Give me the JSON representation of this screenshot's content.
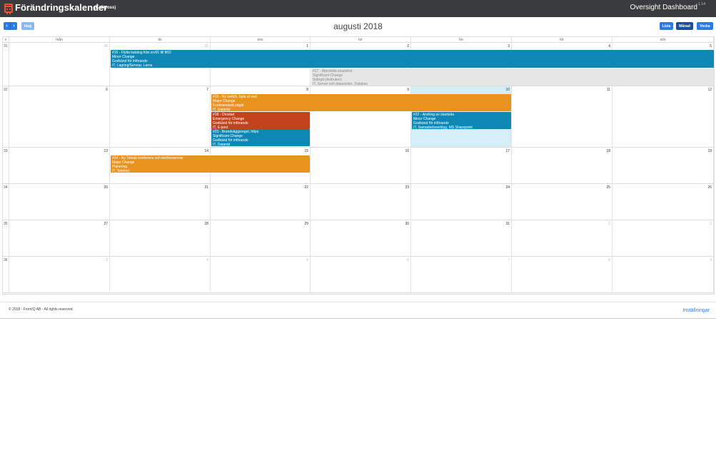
{
  "header": {
    "title": "Förändringskalender",
    "subtitle": "(Kalkyoss)",
    "dashboard_link": "Oversight Dashboard",
    "version": "1.14",
    "icon": "calendar-icon",
    "icon_color": "#e8533a"
  },
  "toolbar": {
    "prev_label": "‹",
    "next_label": "›",
    "today_label": "Idag",
    "heading": "augusti 2018",
    "views": [
      {
        "label": "Lista"
      },
      {
        "label": "Månad"
      },
      {
        "label": "Vecka"
      }
    ]
  },
  "calendar": {
    "week_header": "v",
    "day_headers": [
      "mån",
      "tis",
      "ons",
      "tor",
      "fre",
      "lör",
      "sön"
    ],
    "weeks": [
      {
        "week": "31",
        "days": [
          "30",
          "31",
          "1",
          "2",
          "3",
          "4",
          "5"
        ],
        "other": [
          true,
          true,
          false,
          false,
          false,
          false,
          false
        ]
      },
      {
        "week": "32",
        "days": [
          "6",
          "7",
          "8",
          "9",
          "10",
          "11",
          "12"
        ],
        "other": [
          false,
          false,
          false,
          false,
          false,
          false,
          false
        ]
      },
      {
        "week": "33",
        "days": [
          "13",
          "14",
          "15",
          "16",
          "17",
          "18",
          "19"
        ],
        "other": [
          false,
          false,
          false,
          false,
          false,
          false,
          false
        ]
      },
      {
        "week": "34",
        "days": [
          "20",
          "21",
          "22",
          "23",
          "24",
          "25",
          "26"
        ],
        "other": [
          false,
          false,
          false,
          false,
          false,
          false,
          false
        ]
      },
      {
        "week": "35",
        "days": [
          "27",
          "28",
          "29",
          "30",
          "31",
          "1",
          "2"
        ],
        "other": [
          false,
          false,
          false,
          false,
          false,
          true,
          true
        ]
      },
      {
        "week": "36",
        "days": [
          "3",
          "4",
          "5",
          "6",
          "7",
          "8",
          "9"
        ],
        "other": [
          true,
          true,
          true,
          true,
          true,
          true,
          true
        ]
      }
    ],
    "today": {
      "week_index": 1,
      "day_index": 4
    }
  },
  "events": [
    {
      "id": "ev16",
      "lines": [
        "#16 - Flytta katalog från srv01 till fil02",
        "Minor Change",
        "Godkänd för införande",
        "IT, Lagring/Servrar,  Larna"
      ],
      "color": "blue"
    },
    {
      "id": "ev17",
      "lines": [
        "#17 - Återställa snapshot",
        "Significant Change",
        "Stängd (Avbruten)",
        "IT, Server och datacenter, Databas"
      ],
      "color": "gray"
    },
    {
      "id": "ev19",
      "lines": [
        "#19 - Ny switch, byta ut nod",
        "Major Change",
        "Funktionstest pågår",
        "IT, Datanät"
      ],
      "color": "orange"
    },
    {
      "id": "ev18",
      "lines": [
        "#18 - Omstart",
        "Emergency Change",
        "Godkänd för införande",
        "IT, E-post"
      ],
      "color": "red"
    },
    {
      "id": "ev22",
      "lines": [
        "#22 - Ändring av startsida",
        "Minor Change",
        "Godkänd för införande",
        "IT, Samarbetsverktyg, MS Sharepoint"
      ],
      "color": "blue"
    },
    {
      "id": "ev23",
      "lines": [
        "#23 - Brandväggsregel, https",
        "Significant Change",
        "Godkänd för införande",
        "IT, Datanät"
      ],
      "color": "blue"
    },
    {
      "id": "ev24",
      "lines": [
        "#24 - Ny Telnab konferens och telefonservrar",
        "Major Change",
        "Planering",
        "IT, Telefoni"
      ],
      "color": "orange"
    }
  ],
  "footer": {
    "copyright": "© 2018 - FromIQ AB - All rights reserved.",
    "settings_link": "Inställningar"
  },
  "colors": {
    "blue": "#0e87b4",
    "orange": "#e8931e",
    "red": "#c2431b",
    "gray": "#e6e6e6",
    "today": "#d3eef6",
    "primary": "#2c7be5"
  }
}
